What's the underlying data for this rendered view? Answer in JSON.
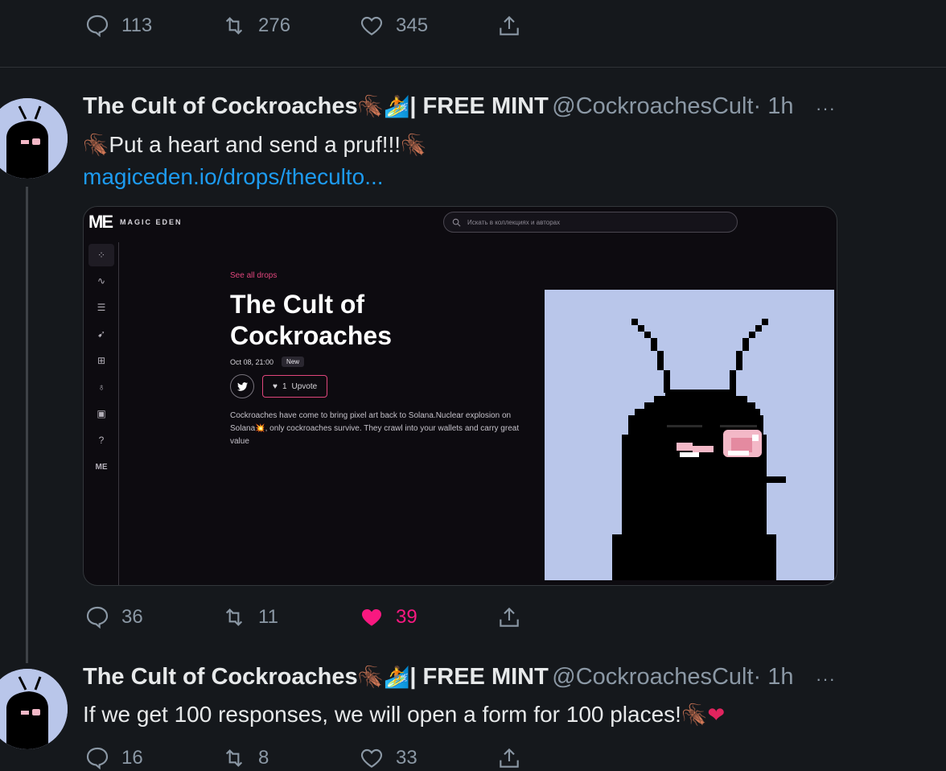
{
  "top_actions": {
    "replies": "113",
    "retweets": "276",
    "likes": "345"
  },
  "tweet1": {
    "name": "The Cult of Cockroaches",
    "name_suffix": "| FREE MINT",
    "handle": "@CockroachesCult",
    "time": "· 1h",
    "more": "···",
    "text": "Put a heart and send a pruf!!!",
    "link": "magiceden.io/drops/theculto...",
    "actions": {
      "replies": "36",
      "retweets": "11",
      "likes": "39"
    }
  },
  "card": {
    "logo": "ME",
    "brand": "MAGIC EDEN",
    "search_placeholder": "Искать в коллекциях и авторах",
    "see_all": "See all drops",
    "title_line1": "The Cult of",
    "title_line2": "Cockroaches",
    "date": "Oct 08, 21:00",
    "badge": "New",
    "upvote_count": "1",
    "upvote_label": "Upvote",
    "description": "Cockroaches have come to bring pixel art back to Solana.Nuclear explosion on Solana💥, only cockroaches survive. They crawl into your wallets and carry great value"
  },
  "tweet2": {
    "name": "The Cult of Cockroaches",
    "name_suffix": "| FREE MINT",
    "handle": "@CockroachesCult",
    "time": "· 1h",
    "more": "···",
    "text": "If we get 100 responses, we will open a form for 100 places!",
    "actions": {
      "replies": "16",
      "retweets": "8",
      "likes": "33"
    }
  },
  "colors": {
    "link": "#1d9bf0",
    "like_active": "#f91880",
    "muted": "#8b98a5",
    "accent_me": "#e0467c"
  }
}
